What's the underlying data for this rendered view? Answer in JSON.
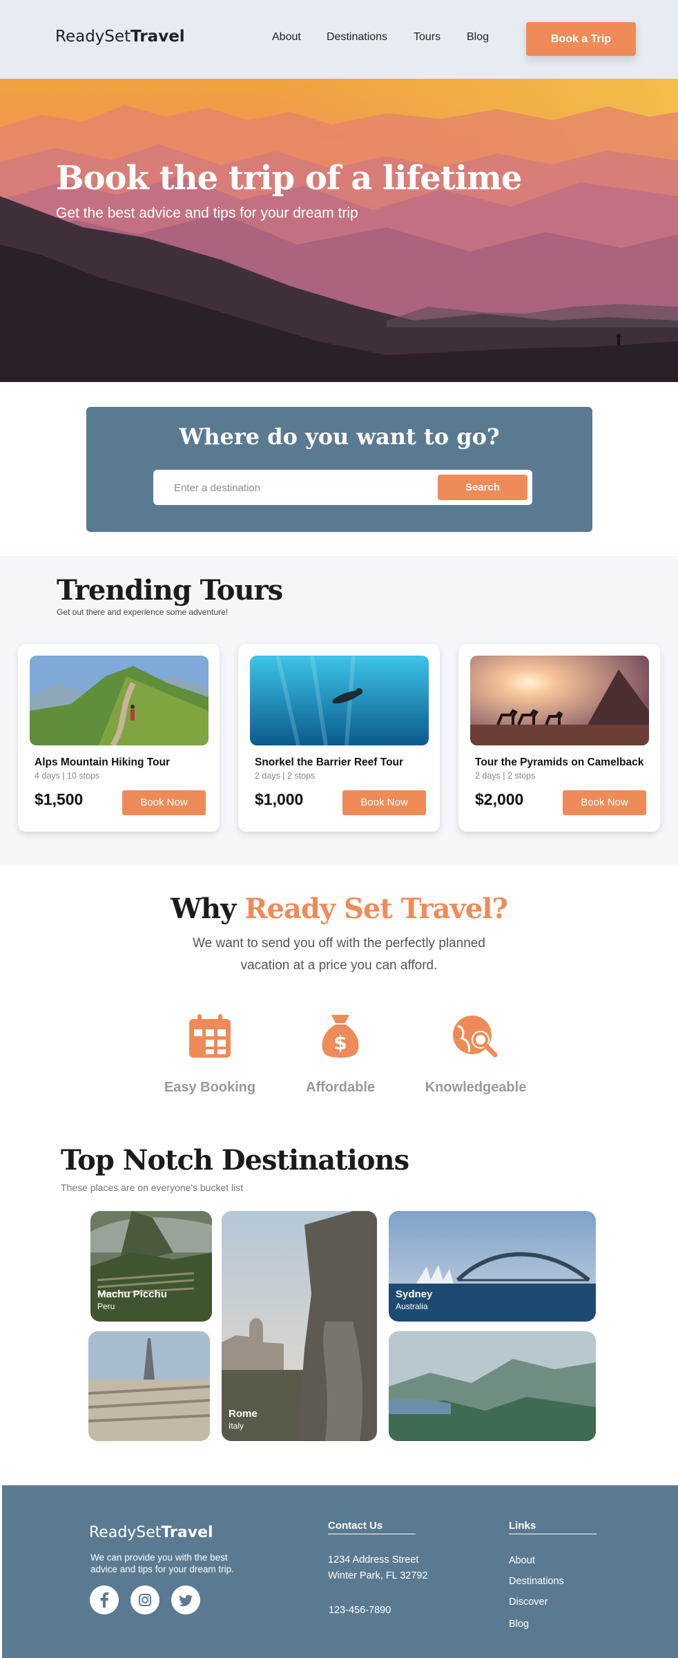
{
  "nav": {
    "logo_light": "ReadySet",
    "logo_bold": "Travel",
    "links": [
      "About",
      "Destinations",
      "Tours",
      "Blog"
    ],
    "cta": "Book a Trip"
  },
  "hero": {
    "title": "Book the trip of a lifetime",
    "subtitle": "Get the best advice and tips for your dream trip"
  },
  "search": {
    "title": "Where do you want to go?",
    "placeholder": "Enter a destination",
    "button": "Search"
  },
  "trending": {
    "title": "Trending Tours",
    "subtitle": "Get out there and experience some adventure!",
    "tours": [
      {
        "name": "Alps Mountain Hiking Tour",
        "meta": "4 days | 10 stops",
        "price": "$1,500",
        "button": "Book Now",
        "image": "alps-hiking-photo"
      },
      {
        "name": "Snorkel the Barrier Reef Tour",
        "meta": "2 days | 2 stops",
        "price": "$1,000",
        "button": "Book Now",
        "image": "snorkel-reef-photo"
      },
      {
        "name": "Tour the Pyramids on Camelback",
        "meta": "2 days | 2 stops",
        "price": "$2,000",
        "button": "Book Now",
        "image": "pyramids-camels-photo"
      }
    ]
  },
  "why": {
    "title_plain": "Why",
    "title_accent": "Ready Set Travel?",
    "description_line1": "We want to send you off with the perfectly planned",
    "description_line2": "vacation at a price you can afford.",
    "features": [
      {
        "label": "Easy Booking",
        "icon": "calendar-icon"
      },
      {
        "label": "Affordable",
        "icon": "money-bag-icon"
      },
      {
        "label": "Knowledgeable",
        "icon": "globe-search-icon"
      }
    ]
  },
  "destinations": {
    "title": "Top Notch Destinations",
    "subtitle": "These places are on everyone's bucket list",
    "items": [
      {
        "name": "Machu Picchu",
        "country": "Peru"
      },
      {
        "name": "Sydney",
        "country": "Australia"
      },
      {
        "name": "Rome",
        "country": "Italy"
      }
    ]
  },
  "footer": {
    "logo_light": "ReadySet",
    "logo_bold": "Travel",
    "description": "We can provide you with the best advice and tips for your dream trip.",
    "contact_heading": "Contact Us",
    "address_line1": "1234 Address Street",
    "address_line2": "Winter Park, FL 32792",
    "phone": "123-456-7890",
    "links_heading": "Links",
    "links": [
      "About",
      "Destinations",
      "Discover",
      "Blog"
    ],
    "social_icons": [
      "facebook-icon",
      "instagram-icon",
      "twitter-icon"
    ]
  },
  "colors": {
    "accent": "#ef8b58",
    "panel": "#5a7a91",
    "nav_bg": "#e7ebf2",
    "section_bg": "#f6f7fa"
  }
}
